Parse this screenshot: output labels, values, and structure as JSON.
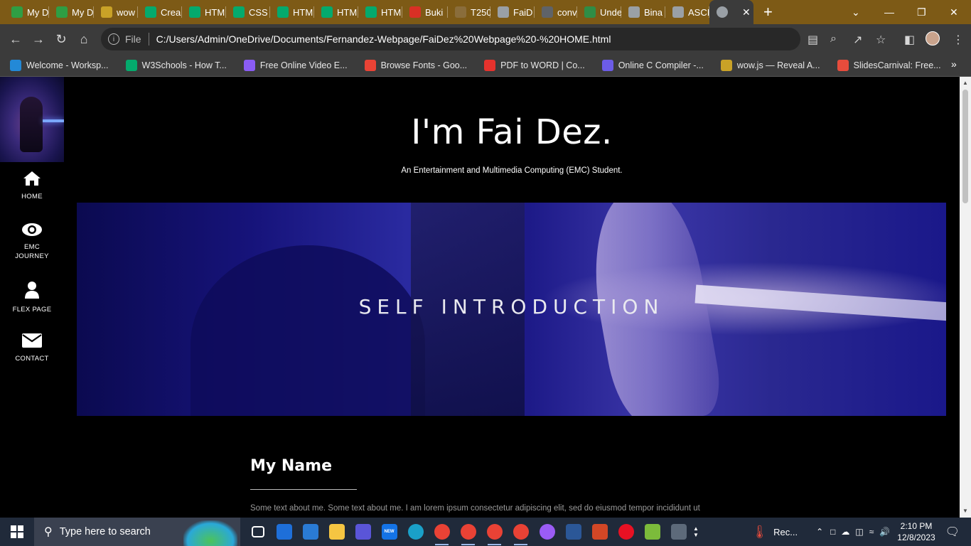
{
  "browser": {
    "tabs": [
      {
        "label": "My D",
        "icon": "google-drive-icon",
        "color": "#2f9e44"
      },
      {
        "label": "My D",
        "icon": "google-drive-icon",
        "color": "#2f9e44"
      },
      {
        "label": "wow",
        "icon": "wowjs-icon",
        "color": "#c9a227"
      },
      {
        "label": "Crea",
        "icon": "w3schools-icon",
        "color": "#04aa6d"
      },
      {
        "label": "HTM",
        "icon": "w3schools-icon",
        "color": "#04aa6d"
      },
      {
        "label": "CSS",
        "icon": "w3schools-icon",
        "color": "#04aa6d"
      },
      {
        "label": "HTM",
        "icon": "w3schools-icon",
        "color": "#04aa6d"
      },
      {
        "label": "HTM",
        "icon": "w3schools-icon",
        "color": "#04aa6d"
      },
      {
        "label": "HTM",
        "icon": "w3schools-icon",
        "color": "#04aa6d"
      },
      {
        "label": "Buki",
        "icon": "gmail-icon",
        "color": "#d93025"
      },
      {
        "label": "T250",
        "icon": "site-icon",
        "color": "#8a6d3b"
      },
      {
        "label": "FaiD",
        "icon": "globe-icon",
        "color": "#9aa0a6"
      },
      {
        "label": "conv",
        "icon": "search-icon",
        "color": "#5f6368"
      },
      {
        "label": "Unde",
        "icon": "gfg-icon",
        "color": "#2f8d46"
      },
      {
        "label": "Bina",
        "icon": "globe-icon",
        "color": "#9aa0a6"
      },
      {
        "label": "ASCI",
        "icon": "globe-icon",
        "color": "#9aa0a6"
      }
    ],
    "active_tab_close": "✕",
    "new_tab": "+",
    "address": {
      "scheme": "File",
      "url": "C:/Users/Admin/OneDrive/Documents/Fernandez-Webpage/FaiDez%20Webpage%20-%20HOME.html"
    },
    "bookmarks": [
      {
        "label": "Welcome - Worksp...",
        "icon": "vscode-icon",
        "color": "#2389d7"
      },
      {
        "label": "W3Schools - How T...",
        "icon": "w3schools-icon",
        "color": "#04aa6d"
      },
      {
        "label": "Free Online Video E...",
        "icon": "video-editor-icon",
        "color": "#8a5cf5"
      },
      {
        "label": "Browse Fonts - Goo...",
        "icon": "google-fonts-icon",
        "color": "#ea4335"
      },
      {
        "label": "PDF to WORD | Co...",
        "icon": "pdf-heart-icon",
        "color": "#e5322d"
      },
      {
        "label": "Online C Compiler -...",
        "icon": "bolt-icon",
        "color": "#6c5ce7"
      },
      {
        "label": "wow.js — Reveal A...",
        "icon": "wowjs-icon",
        "color": "#c9a227"
      },
      {
        "label": "SlidesCarnival: Free...",
        "icon": "slidescarnival-icon",
        "color": "#e74c3c"
      }
    ]
  },
  "page": {
    "sidebar": {
      "nav": [
        {
          "label": "HOME",
          "icon": "home-icon"
        },
        {
          "label": "EMC\nJOURNEY",
          "icon": "eye-icon"
        },
        {
          "label": "FLEX PAGE",
          "icon": "user-icon"
        },
        {
          "label": "CONTACT",
          "icon": "envelope-icon"
        }
      ]
    },
    "hero": {
      "title": "I'm Fai Dez.",
      "subtitle": "An Entertainment and Multimedia Computing (EMC) Student."
    },
    "banner": {
      "caption": "SELF INTRODUCTION"
    },
    "section": {
      "title": "My Name",
      "text": "Some text about me. Some text about me. I am lorem ipsum consectetur adipiscing elit, sed do eiusmod tempor incididunt ut"
    }
  },
  "taskbar": {
    "search_placeholder": "Type here to search",
    "apps": [
      {
        "icon": "task-view-icon"
      },
      {
        "icon": "mail-icon",
        "color": "#1e6fd9"
      },
      {
        "icon": "store-icon",
        "color": "#2a7bd4"
      },
      {
        "icon": "file-explorer-icon",
        "color": "#f5c542"
      },
      {
        "icon": "app-icon",
        "color": "#5a55d8"
      },
      {
        "icon": "outlook-icon",
        "color": "#1473e6",
        "badge": "NEW"
      },
      {
        "icon": "edge-icon",
        "color": "#1aa0c8"
      },
      {
        "icon": "chrome-icon",
        "color": "#e94235"
      },
      {
        "icon": "chrome-icon",
        "color": "#e94235"
      },
      {
        "icon": "chrome-icon",
        "color": "#e94235"
      },
      {
        "icon": "chrome-icon",
        "color": "#e94235"
      },
      {
        "icon": "messenger-icon",
        "color": "#9a5cf5"
      },
      {
        "icon": "word-icon",
        "color": "#2b5797"
      },
      {
        "icon": "powerpoint-icon",
        "color": "#d24726"
      },
      {
        "icon": "recorder-icon",
        "color": "#e81123"
      },
      {
        "icon": "notepad-icon",
        "color": "#7cbb3b"
      },
      {
        "icon": "calculator-icon",
        "color": "#5d6a7a"
      }
    ],
    "weather_label": "Rec...",
    "time": "2:10 PM",
    "date": "12/8/2023"
  }
}
